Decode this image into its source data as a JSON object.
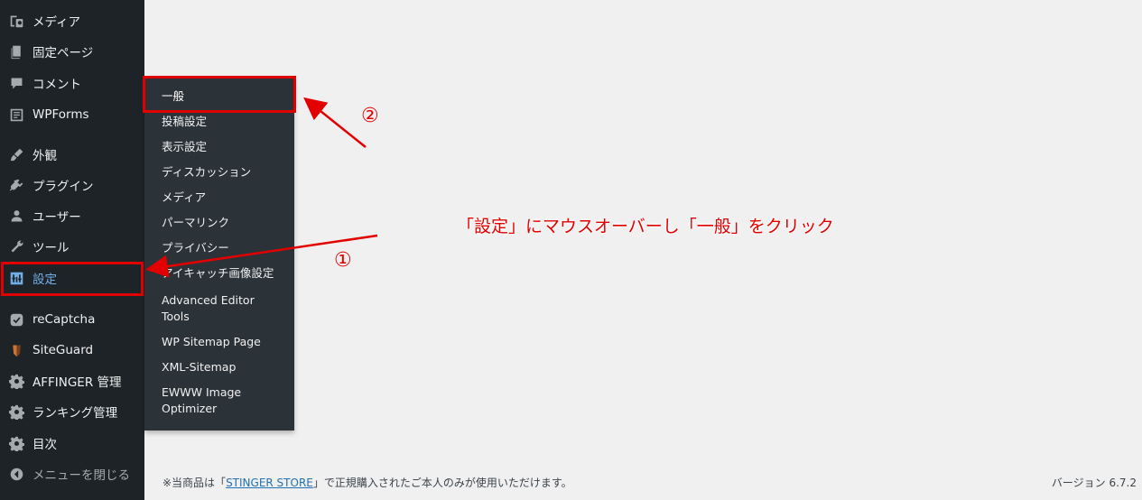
{
  "sidebar": {
    "items": [
      {
        "label": "メディア",
        "icon": "media-icon"
      },
      {
        "label": "固定ページ",
        "icon": "page-icon"
      },
      {
        "label": "コメント",
        "icon": "comment-icon"
      },
      {
        "label": "WPForms",
        "icon": "wpforms-icon"
      },
      {
        "label": "外観",
        "icon": "appearance-brush-icon"
      },
      {
        "label": "プラグイン",
        "icon": "plugin-icon"
      },
      {
        "label": "ユーザー",
        "icon": "user-icon"
      },
      {
        "label": "ツール",
        "icon": "wrench-icon"
      },
      {
        "label": "設定",
        "icon": "settings-icon",
        "current": true
      },
      {
        "label": "reCaptcha",
        "icon": "check-shield-icon"
      },
      {
        "label": "SiteGuard",
        "icon": "siteguard-shield-icon"
      },
      {
        "label": "AFFINGER 管理",
        "icon": "gear-icon"
      },
      {
        "label": "ランキング管理",
        "icon": "gear-icon"
      },
      {
        "label": "目次",
        "icon": "gear-icon"
      }
    ],
    "collapse_label": "メニューを閉じる"
  },
  "settings_submenu": {
    "items": [
      "一般",
      "投稿設定",
      "表示設定",
      "ディスカッション",
      "メディア",
      "パーマリンク",
      "プライバシー",
      "アイキャッチ画像設定",
      "Advanced Editor Tools",
      "WP Sitemap Page",
      "XML-Sitemap",
      "EWWW Image Optimizer"
    ]
  },
  "annotations": {
    "step1": "①",
    "step2": "②",
    "instruction": "「設定」にマウスオーバーし「一般」をクリック",
    "color": "#e30000"
  },
  "footer": {
    "text_before": "※当商品は「",
    "link": "STINGER STORE",
    "text_after": "」で正規購入されたご本人のみが使用いただけます。",
    "version": "バージョン 6.7.2"
  }
}
